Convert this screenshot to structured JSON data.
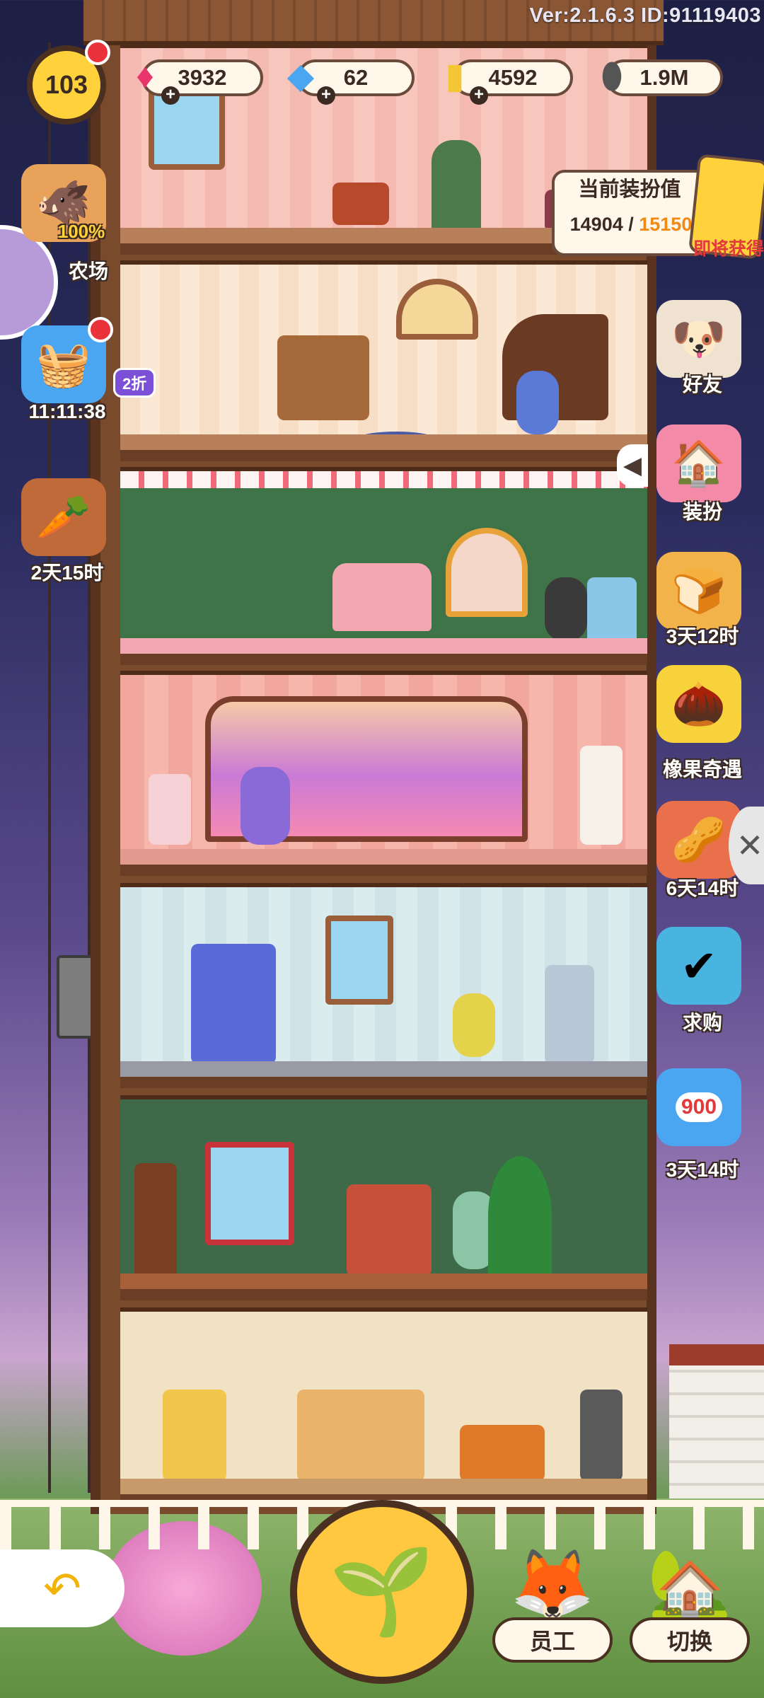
{
  "version": "Ver:2.1.6.3 ID:91119403",
  "level": "103",
  "resources": [
    {
      "name": "gem",
      "icon": "gem-icon",
      "value": "3932",
      "color": "#e8356c"
    },
    {
      "name": "ticket",
      "icon": "ticket-icon",
      "value": "62",
      "color": "#4aa6f0"
    },
    {
      "name": "coupon",
      "icon": "coupon-icon",
      "value": "4592",
      "color": "#f4c534"
    },
    {
      "name": "seed",
      "icon": "sunflower-seed-icon",
      "value": "1.9M",
      "color": "#555555"
    }
  ],
  "decoration": {
    "title": "当前装扮值",
    "current": "14904",
    "separator": " / ",
    "max": "15150",
    "reward_label": "即将获得"
  },
  "left_icons": [
    {
      "name": "farm",
      "icon": "boar-farm-icon",
      "label": "农场",
      "percent": "100%"
    },
    {
      "name": "shop-basket",
      "icon": "basket-icon",
      "label": "11:11:38",
      "badge": "2折"
    },
    {
      "name": "carrot-basket",
      "icon": "carrot-basket-icon",
      "label": "2天15时"
    }
  ],
  "right_icons": [
    {
      "name": "friends",
      "icon": "friends-icon",
      "label": "好友"
    },
    {
      "name": "dress-up",
      "icon": "dress-up-icon",
      "label": "装扮"
    },
    {
      "name": "golden-bun",
      "icon": "golden-bun-icon",
      "label": "3天12时"
    },
    {
      "name": "acorn-event",
      "icon": "acorn-icon",
      "label": "橡果奇遇"
    },
    {
      "name": "nut-pack",
      "icon": "nut-pack-icon",
      "label": "6天14时"
    },
    {
      "name": "purchase",
      "icon": "purchase-icon",
      "label": "求购"
    },
    {
      "name": "discount",
      "icon": "discount-icon",
      "label": "3天14时",
      "tag": "900"
    }
  ],
  "bottom": {
    "back_icon": "back-arrow-icon",
    "plant_icon": "sprout-icon",
    "staff_label": "员工",
    "switch_label": "切换"
  },
  "colors": {
    "accent": "#ffd23c",
    "outline": "#4a3020",
    "alert": "#e9323a"
  }
}
